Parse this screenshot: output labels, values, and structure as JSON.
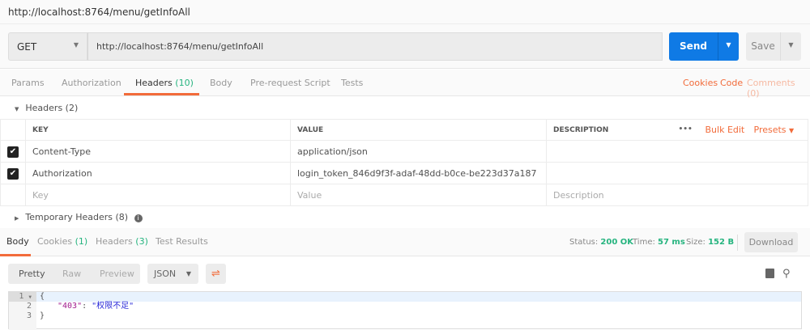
{
  "title": "http://localhost:8764/menu/getInfoAll",
  "request": {
    "method": "GET",
    "url": "http://localhost:8764/menu/getInfoAll",
    "send": "Send",
    "save": "Save"
  },
  "tabs": [
    {
      "label": "Params"
    },
    {
      "label": "Authorization"
    },
    {
      "label": "Headers",
      "count": "(10)"
    },
    {
      "label": "Body"
    },
    {
      "label": "Pre-request Script"
    },
    {
      "label": "Tests"
    }
  ],
  "links": {
    "cookies": "Cookies",
    "code": "Code",
    "comments": "Comments (0)"
  },
  "headers_section": "Headers (2)",
  "table": {
    "columns": [
      "KEY",
      "VALUE",
      "DESCRIPTION"
    ],
    "dots": "•••",
    "bulk_edit": "Bulk Edit",
    "presets": "Presets",
    "rows": [
      {
        "key": "Content-Type",
        "value": "application/json",
        "checked": true
      },
      {
        "key": "Authorization",
        "value": "login_token_846d9f3f-adaf-48dd-b0ce-be223d37a187",
        "checked": true
      }
    ],
    "placeholders": {
      "key": "Key",
      "value": "Value",
      "description": "Description"
    }
  },
  "temp_headers": "Temporary Headers (8)",
  "response": {
    "tabs": [
      {
        "label": "Body"
      },
      {
        "label": "Cookies",
        "count": "(1)"
      },
      {
        "label": "Headers",
        "count": "(3)"
      },
      {
        "label": "Test Results"
      }
    ],
    "status_label": "Status:",
    "status": "200 OK",
    "time_label": "Time:",
    "time": "57 ms",
    "size_label": "Size:",
    "size": "152 B",
    "download": "Download",
    "views": [
      "Pretty",
      "Raw",
      "Preview"
    ],
    "format": "JSON",
    "lines": [
      "1",
      "2",
      "3"
    ],
    "code": {
      "open": "{",
      "key": "\"403\"",
      "colon": ": ",
      "value": "\"权限不足\"",
      "close": "}"
    }
  },
  "colors": {
    "accent": "#f26b3a",
    "send": "#0f7ae5",
    "green": "#26b47f"
  }
}
